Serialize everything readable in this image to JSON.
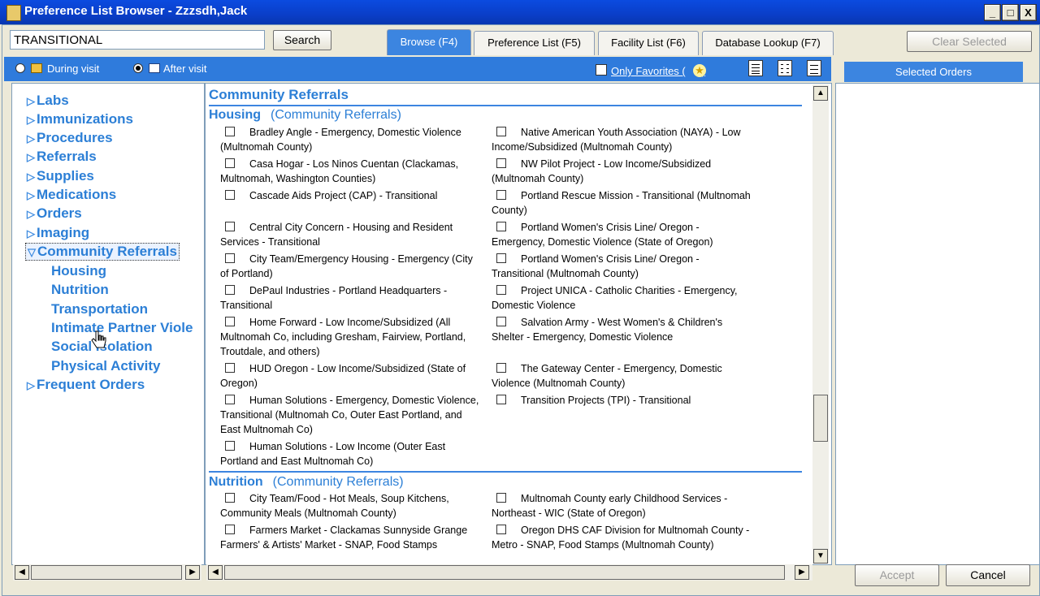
{
  "window": {
    "title": "Preference List Browser - Zzzsdh,Jack",
    "btn_min": "_",
    "btn_max": "□",
    "btn_close": "X"
  },
  "search": {
    "value": "TRANSITIONAL",
    "button": "Search"
  },
  "tabs": [
    {
      "label": "Browse (F4)",
      "active": true
    },
    {
      "label": "Preference List (F5)"
    },
    {
      "label": "Facility List (F6)"
    },
    {
      "label": "Database Lookup (F7)"
    }
  ],
  "clear_selected": "Clear Selected",
  "options": {
    "during_visit": "During visit",
    "after_visit": "After visit",
    "selected": "after_visit"
  },
  "only_favorites": "Only Favorites (",
  "only_favorites_end": ")",
  "star": "★",
  "selected_orders_header": "Selected Orders",
  "tree": {
    "items": [
      "Labs",
      "Immunizations",
      "Procedures",
      "Referrals",
      "Supplies",
      "Medications",
      "Orders",
      "Imaging",
      "Community Referrals",
      "Frequent Orders"
    ],
    "expanded": "Community Referrals",
    "subitems": [
      "Housing",
      "Nutrition",
      "Transportation",
      "Intimate Partner Viole",
      "Social Isolation",
      "Physical Activity"
    ]
  },
  "content": {
    "header": "Community Referrals",
    "sections": [
      {
        "name": "Housing",
        "parent": "(Community Referrals)",
        "left": [
          "Bradley Angle - Emergency, Domestic Violence (Multnomah County)",
          "Casa Hogar - Los Ninos Cuentan (Clackamas, Multnomah, Washington Counties)",
          "Cascade Aids Project (CAP) - Transitional",
          "Central City Concern - Housing and Resident Services - Transitional",
          "City Team/Emergency Housing - Emergency (City of Portland)",
          "DePaul Industries - Portland Headquarters - Transitional",
          "Home Forward - Low Income/Subsidized (All Multnomah Co, including Gresham, Fairview, Portland, Troutdale, and others)",
          "HUD Oregon - Low Income/Subsidized (State of Oregon)",
          "Human Solutions - Emergency, Domestic Violence, Transitional (Multnomah Co, Outer East Portland, and East Multnomah Co)",
          "Human Solutions - Low Income (Outer East Portland and East Multnomah Co)"
        ],
        "right": [
          "Native American Youth Association (NAYA) - Low Income/Subsidized (Multnomah County)",
          "NW Pilot Project - Low Income/Subsidized (Multnomah County)",
          "Portland Rescue Mission - Transitional (Multnomah County)",
          "Portland Women's Crisis Line/ Oregon - Emergency, Domestic Violence (State of Oregon)",
          "Portland Women's Crisis Line/ Oregon - Transitional (Multnomah County)",
          "Project UNICA - Catholic Charities - Emergency, Domestic Violence",
          "Salvation Army - West Women's & Children's Shelter - Emergency, Domestic Violence",
          "The Gateway Center - Emergency, Domestic Violence (Multnomah County)",
          "Transition Projects (TPI) - Transitional"
        ]
      },
      {
        "name": "Nutrition",
        "parent": "(Community Referrals)",
        "left": [
          "City Team/Food - Hot Meals, Soup Kitchens, Community Meals (Multnomah County)",
          "Farmers Market - Clackamas Sunnyside Grange Farmers' & Artists' Market - SNAP, Food Stamps"
        ],
        "right": [
          "Multnomah County early Childhood Services - Northeast - WIC (State of Oregon)",
          "Oregon DHS CAF Division for Multnomah County - Metro - SNAP, Food Stamps (Multnomah County)"
        ]
      }
    ]
  },
  "buttons": {
    "accept": "Accept",
    "cancel": "Cancel"
  },
  "colors": {
    "titlebar": "#0a3ec8",
    "accent": "#3c85e0",
    "link": "#2c7fd6"
  }
}
